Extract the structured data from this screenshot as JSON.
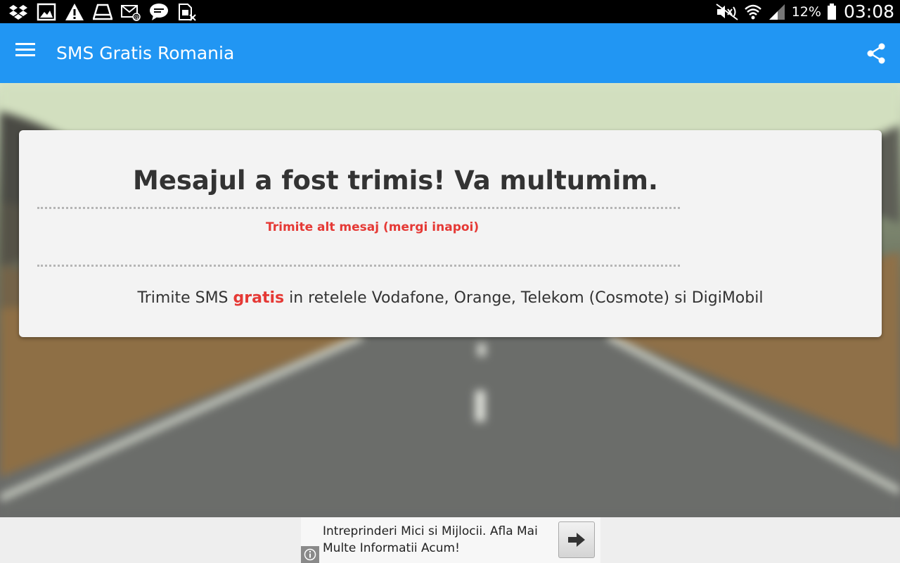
{
  "status_bar": {
    "notification_icons": [
      "dropbox-icon",
      "gallery-icon",
      "warning-icon",
      "drive-icon",
      "email-icon",
      "chat-icon",
      "sim-icon"
    ],
    "battery_percent": "12%",
    "time": "03:08"
  },
  "app_bar": {
    "title": "SMS Gratis Romania"
  },
  "card": {
    "title": "Mesajul a fost trimis! Va multumim.",
    "back_link": "Trimite alt mesaj (mergi inapoi)",
    "tagline_prefix": "Trimite SMS ",
    "tagline_accent": "gratis",
    "tagline_suffix": " in retelele Vodafone, Orange, Telekom (Cosmote) si DigiMobil"
  },
  "ad": {
    "text": "Intreprinderi Mici si Mijlocii. Afla Mai Multe Informatii Acum!"
  },
  "colors": {
    "app_bar": "#2196f3",
    "accent": "#e53935",
    "card": "#f3f3f3"
  }
}
